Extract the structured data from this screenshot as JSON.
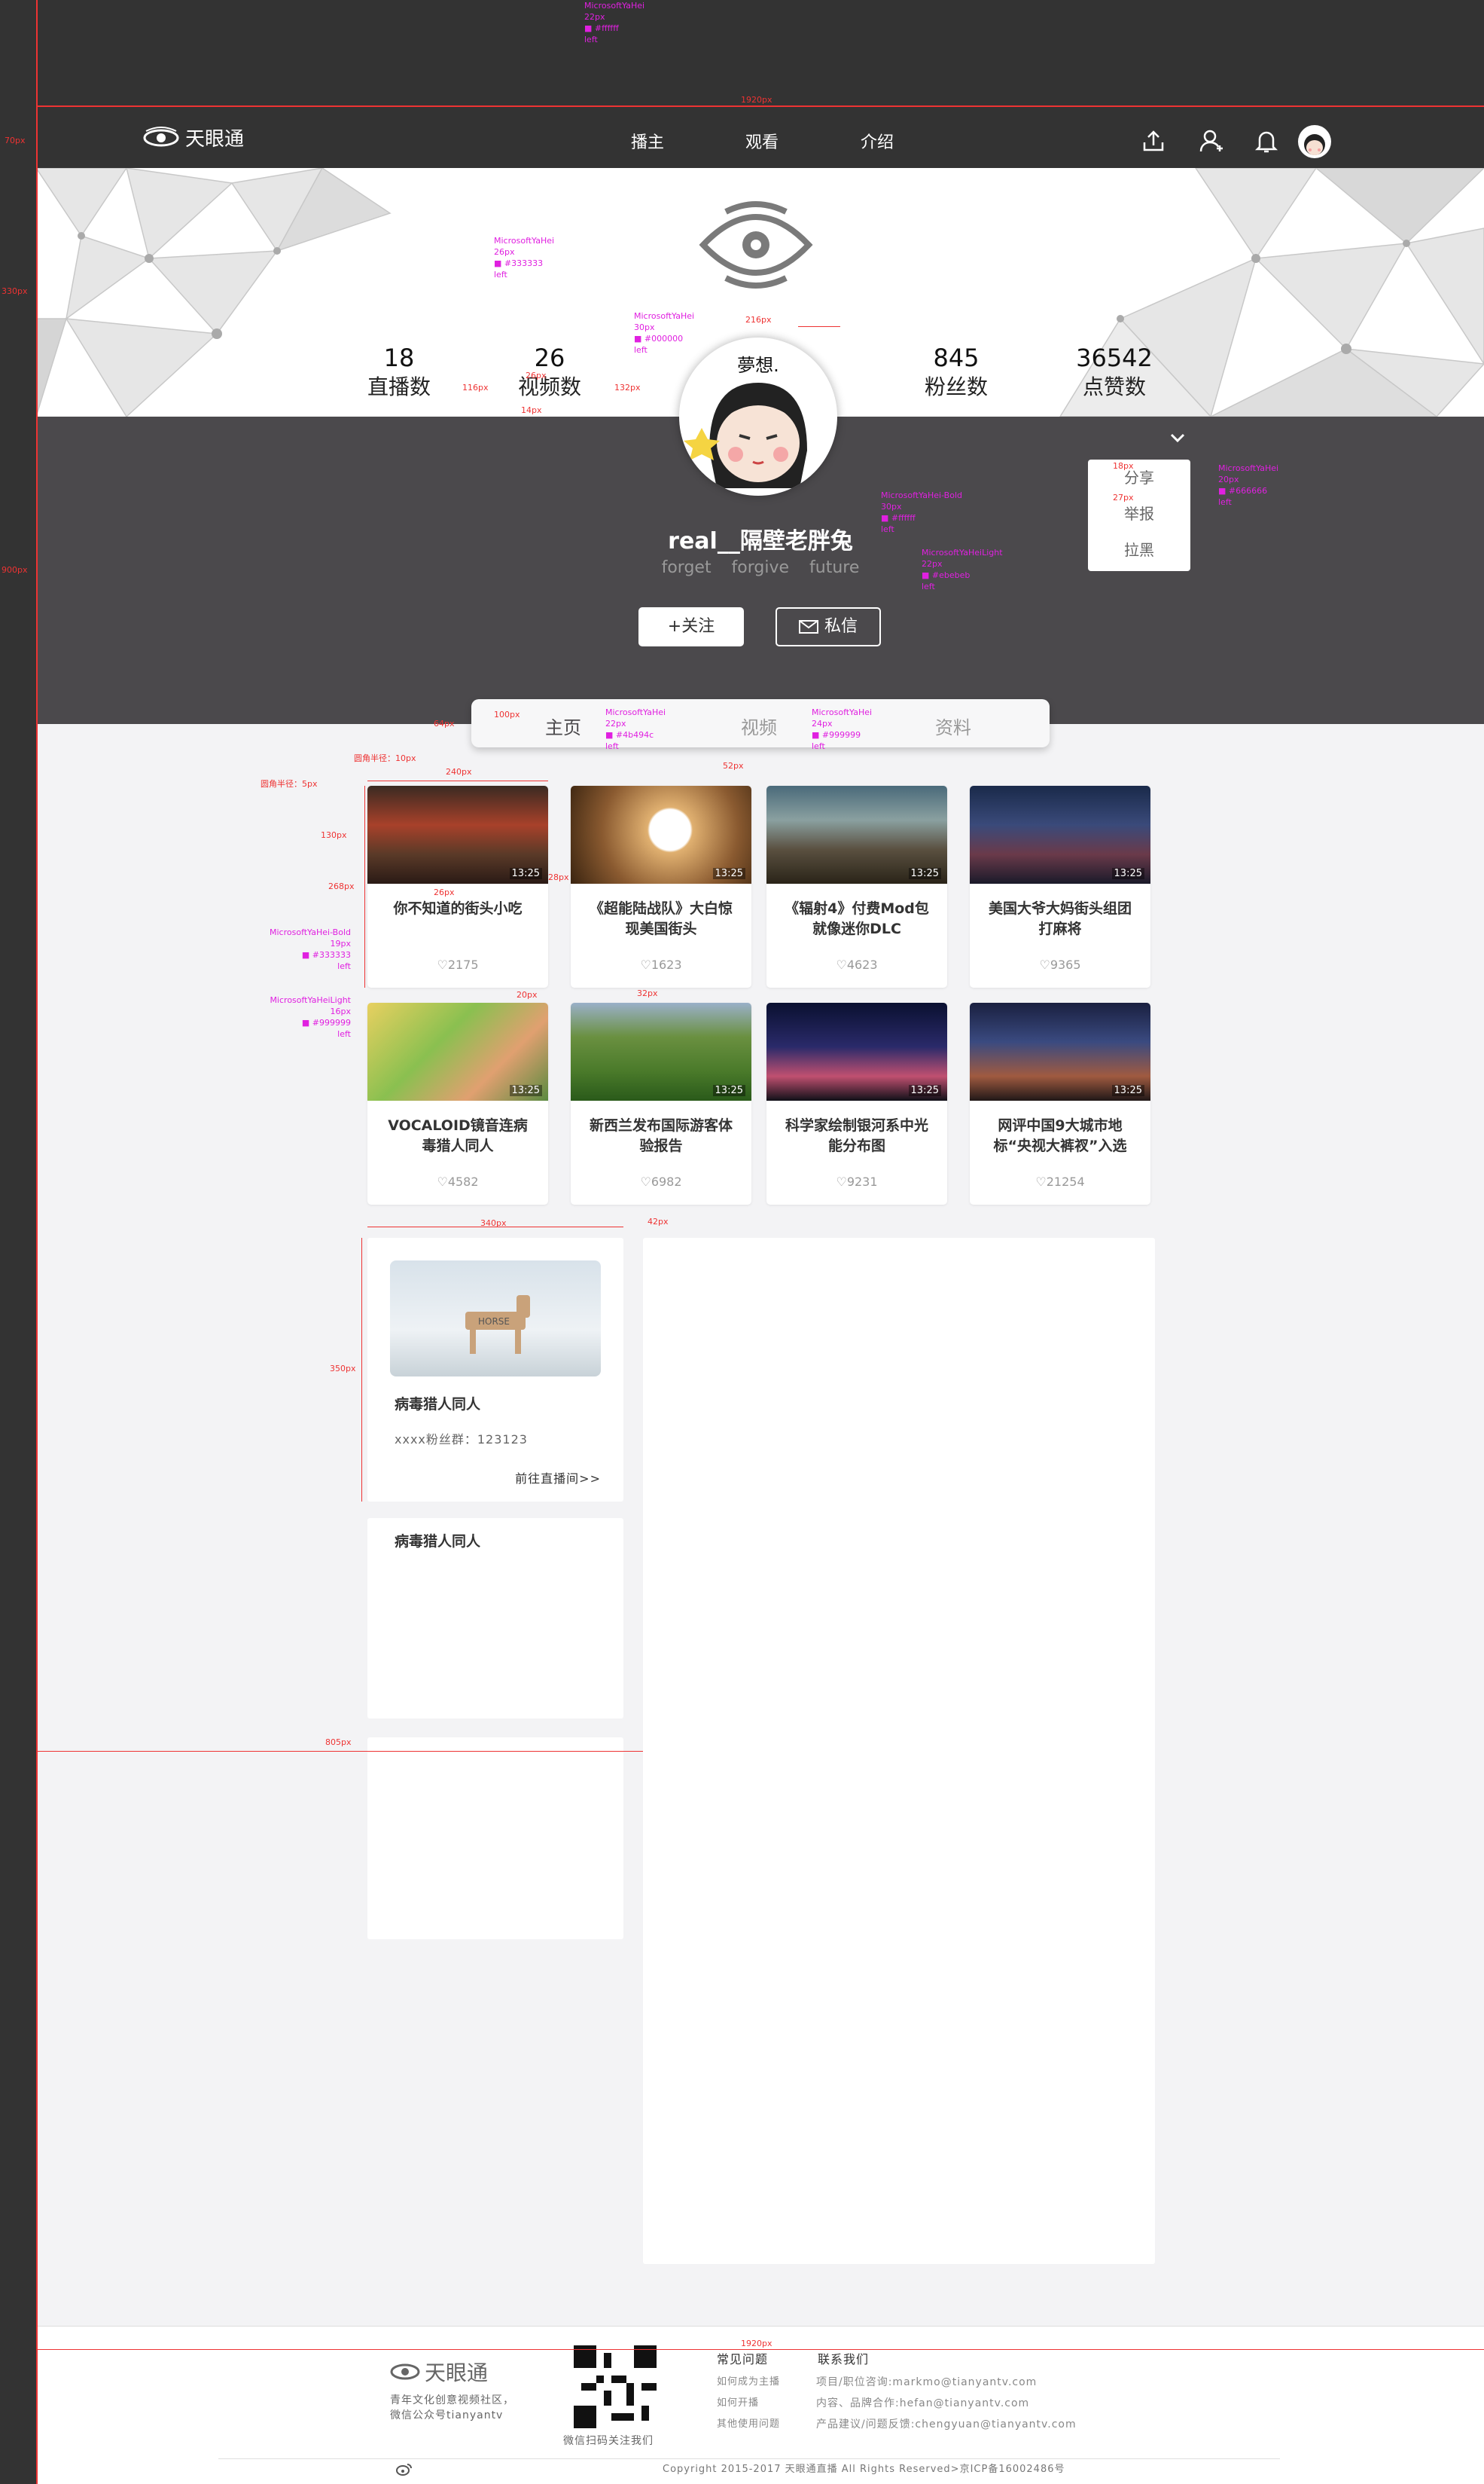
{
  "nav": {
    "brand": "天眼通",
    "links": [
      "播主",
      "观看",
      "介绍"
    ],
    "icons": [
      "upload-icon",
      "user-icon",
      "bell-icon",
      "avatar"
    ]
  },
  "profile": {
    "stats": [
      {
        "value": "18",
        "label": "直播数"
      },
      {
        "value": "26",
        "label": "视频数"
      },
      {
        "value": "845",
        "label": "粉丝数"
      },
      {
        "value": "36542",
        "label": "点赞数"
      }
    ],
    "username": "real__隔壁老胖兔",
    "motto": "forget  forgive  future",
    "follow_label": "+关注",
    "message_label": "私信",
    "menu": [
      "分享",
      "举报",
      "拉黑"
    ]
  },
  "tabs": [
    "主页",
    "视频",
    "资料"
  ],
  "videos": [
    {
      "title": "你不知道的街头小吃",
      "likes": "2175",
      "duration": "13:25"
    },
    {
      "title": "《超能陆战队》大白惊现美国街头",
      "likes": "1623",
      "duration": "13:25"
    },
    {
      "title": "《辐射4》付费Mod包就像迷你DLC",
      "likes": "4623",
      "duration": "13:25"
    },
    {
      "title": "美国大爷大妈街头组团打麻将",
      "likes": "9365",
      "duration": "13:25"
    },
    {
      "title": "VOCALOID镜音连病毒猎人同人",
      "likes": "4582",
      "duration": "13:25"
    },
    {
      "title": "新西兰发布国际游客体验报告",
      "likes": "6982",
      "duration": "13:25"
    },
    {
      "title": "科学家绘制银河系中光能分布图",
      "likes": "9231",
      "duration": "13:25"
    },
    {
      "title": "网评中国9大城市地标“央视大裤衩”入选",
      "likes": "21254",
      "duration": "13:25"
    }
  ],
  "live_card": {
    "title": "病毒猎人同人",
    "fans": "xxxx粉丝群：123123",
    "link": "前往直播间>>",
    "image_text": "HORSE"
  },
  "second_card": {
    "title": "病毒猎人同人"
  },
  "footer": {
    "brand": "天眼通",
    "slogan1": "青年文化创意视频社区，",
    "slogan2": "微信公众号tianyantv",
    "qr_caption": "微信扫码关注我们",
    "faq_title": "常见问题",
    "faq": [
      "如何成为主播",
      "如何开播",
      "其他使用问题"
    ],
    "contact_title": "联系我们",
    "contact": [
      "项目/职位咨询:markmo@tianyantv.com",
      "内容、品牌合作:hefan@tianyantv.com",
      "产品建议/问题反馈:chengyuan@tianyantv.com"
    ],
    "copyright": "Copyright  2015-2017 天眼通直播 All Rights Reserved>京ICP备16002486号"
  },
  "annotations": {
    "a1": [
      "MicrosoftYaHei",
      "22px",
      "■ #ffffff",
      "left"
    ],
    "a2": [
      "MicrosoftYaHei",
      "26px",
      "■ #333333",
      "left"
    ],
    "a3": [
      "MicrosoftYaHei",
      "30px",
      "■ #000000",
      "left"
    ],
    "a4": [
      "MicrosoftYaHei-Bold",
      "30px",
      "■ #ffffff",
      "left"
    ],
    "a5": [
      "MicrosoftYaHeiLight",
      "22px",
      "■ #ebebeb",
      "left"
    ],
    "a6": [
      "MicrosoftYaHei",
      "20px",
      "■ #666666",
      "left"
    ],
    "a7": [
      "MicrosoftYaHei",
      "22px",
      "■ #4b494c",
      "left"
    ],
    "a8": [
      "MicrosoftYaHei",
      "24px",
      "■ #999999",
      "left"
    ],
    "a9": [
      "MicrosoftYaHei-Bold",
      "19px",
      "■ #333333",
      "left"
    ],
    "a10": [
      "MicrosoftYaHeiLight",
      "16px",
      "■ #999999",
      "left"
    ],
    "dims": [
      "1920px",
      "70px",
      "330px",
      "900px",
      "116px",
      "14px",
      "216px",
      "26px",
      "132px",
      "18px",
      "27px",
      "100px",
      "64px",
      "240px",
      "130px",
      "268px",
      "26px",
      "28px",
      "32px",
      "20px",
      "340px",
      "42px",
      "350px",
      "805px",
      "1920px",
      "52px"
    ],
    "radius1": "圆角半径：10px",
    "radius2": "圆角半径：5px"
  }
}
